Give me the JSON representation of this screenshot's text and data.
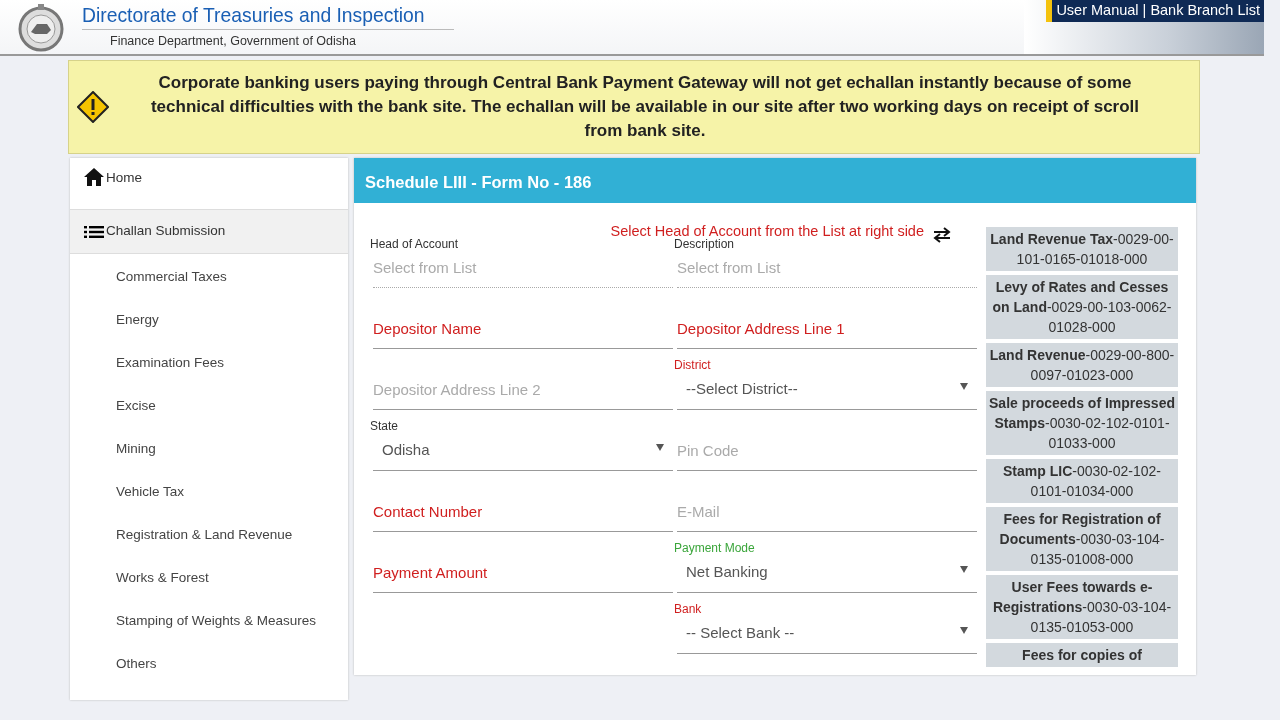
{
  "header": {
    "title": "Directorate of Treasuries and Inspection",
    "subtitle": "Finance Department, Government of Odisha",
    "links": [
      {
        "kind": "link",
        "label": "User Manual"
      },
      {
        "kind": "separator",
        "label": "|"
      },
      {
        "kind": "link",
        "label": "Bank Branch List"
      }
    ]
  },
  "notice": {
    "text": "Corporate banking users paying through Central Bank Payment Gateway will not get echallan instantly because of some technical difficulties with the bank site. The echallan will be available in our site after two working days on receipt of scroll from bank site."
  },
  "sidebar": {
    "items": [
      {
        "label": "Home",
        "kind": "home",
        "selected": false
      },
      {
        "label": "Challan Submission",
        "kind": "list",
        "selected": true,
        "children": [
          {
            "label": "Commercial Taxes"
          },
          {
            "label": "Energy"
          },
          {
            "label": "Examination Fees"
          },
          {
            "label": "Excise"
          },
          {
            "label": "Mining"
          },
          {
            "label": "Vehicle Tax"
          },
          {
            "label": "Registration & Land Revenue"
          },
          {
            "label": "Works & Forest"
          },
          {
            "label": "Stamping of Weights & Measures"
          },
          {
            "label": "Others"
          }
        ]
      }
    ]
  },
  "form": {
    "title": "Schedule LIII - Form No - 186",
    "hint": "Select Head of Account from the List at right side",
    "rows": [
      {
        "left": {
          "kind": "readonly",
          "label": "Head of Account",
          "placeholder": "Select from List",
          "required": false,
          "valid": false
        },
        "right": {
          "kind": "readonly",
          "label": "Description",
          "placeholder": "Select from List",
          "required": false,
          "valid": false
        }
      },
      {
        "left": {
          "kind": "text",
          "placeholder": "Depositor Name",
          "required": true,
          "valid": false
        },
        "right": {
          "kind": "text",
          "placeholder": "Depositor Address Line 1",
          "required": true,
          "valid": false
        }
      },
      {
        "left": {
          "kind": "text",
          "placeholder": "Depositor Address Line 2",
          "required": false,
          "valid": false
        },
        "right": {
          "kind": "select",
          "label": "District",
          "value": "--Select District--",
          "required": true,
          "valid": false
        }
      },
      {
        "left": {
          "kind": "select",
          "label": "State",
          "value": "Odisha",
          "required": false,
          "valid": false
        },
        "right": {
          "kind": "text",
          "placeholder": "Pin Code",
          "required": false,
          "valid": false
        }
      },
      {
        "left": {
          "kind": "text",
          "placeholder": "Contact Number",
          "required": true,
          "valid": false
        },
        "right": {
          "kind": "text",
          "placeholder": "E-Mail",
          "required": false,
          "valid": false
        }
      },
      {
        "left": {
          "kind": "text",
          "placeholder": "Payment Amount",
          "required": true,
          "valid": false
        },
        "right": {
          "kind": "select",
          "label": "Payment Mode",
          "value": "Net Banking",
          "required": false,
          "valid": true
        }
      },
      {
        "right": {
          "kind": "select",
          "label": "Bank",
          "value": "-- Select Bank --",
          "required": true,
          "valid": false
        }
      }
    ]
  },
  "heads": [
    "**Land Revenue Tax**-0029-00-101-0165-01018-000",
    "**Levy of Rates and Cesses on Land**-0029-00-103-0062-01028-000",
    "**Land Revenue**-0029-00-800-0097-01023-000",
    "**Sale proceeds of Impressed Stamps**-0030-02-102-0101-01033-000",
    "**Stamp LIC**-0030-02-102-0101-01034-000",
    "**Fees for Registration of Documents**-0030-03-104-0135-01008-000",
    "**User Fees towards e-Registrations**-0030-03-104-0135-01053-000",
    "**Fees for copies of**"
  ]
}
